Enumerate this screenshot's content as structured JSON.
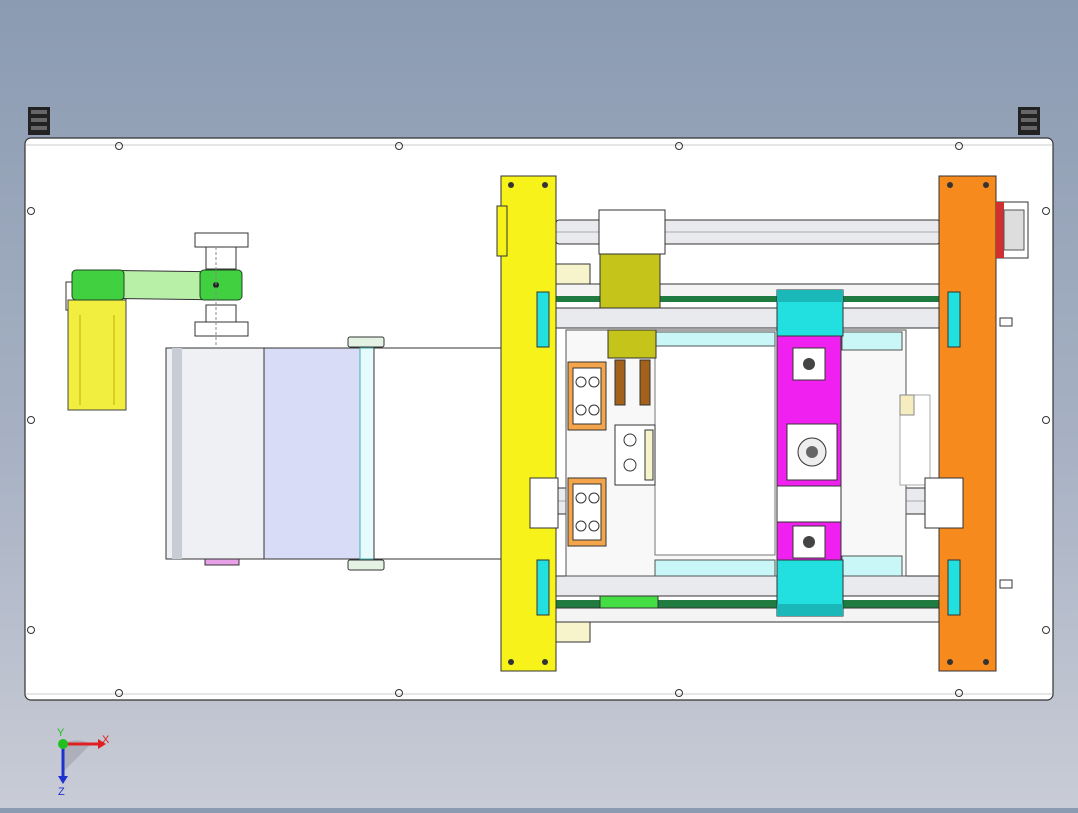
{
  "view": {
    "background_top": "#8b9bb2",
    "background_bottom": "#c9ccd6"
  },
  "triad": {
    "x_label": "X",
    "y_label": "Y",
    "z_label": "Z",
    "x_color": "#e02020",
    "y_color": "#20c020",
    "z_color": "#2030d0"
  },
  "parts": {
    "base_plate": "#ffffff",
    "left_frame": "#f7f21a",
    "right_frame": "#f78a1c",
    "slider_block": "#f020f0",
    "cyan_blocks": "#22e0e0",
    "olive_block": "#c4c41a",
    "motor": "#f2ee40",
    "belt": "#b8f0a8",
    "film_roll": "#d8dcf6",
    "green_bar": "#44dd44"
  }
}
